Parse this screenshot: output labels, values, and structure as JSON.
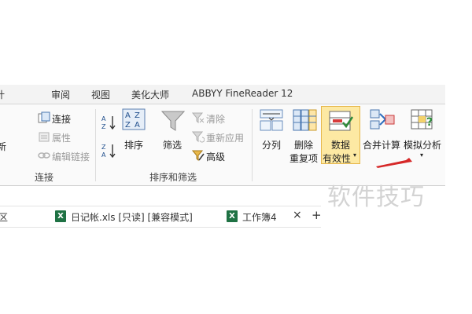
{
  "menu_tabs": {
    "left_fragment": "计",
    "review": "审阅",
    "view": "视图",
    "beautify": "美化大师",
    "abbyy": "ABBYY FineReader 12"
  },
  "ribbon": {
    "connections_group": {
      "left_fragment": "新",
      "connections": "连接",
      "properties": "属性",
      "edit_links": "编辑链接",
      "label": "连接"
    },
    "sort_filter_group": {
      "sort": "排序",
      "filter": "筛选",
      "clear": "清除",
      "reapply": "重新应用",
      "advanced": "高级",
      "label": "排序和筛选"
    },
    "data_tools_group": {
      "text_to_columns": "分列",
      "remove_duplicates_line1": "删除",
      "remove_duplicates_line2": "重复项",
      "data_validation_line1": "数据",
      "data_validation_line2": "有效性",
      "consolidate": "合并计算",
      "what_if": "模拟分析"
    }
  },
  "watermark": "软件技巧",
  "file_tabs": {
    "left_fragment": "区",
    "file1": "日记帐.xls  [只读]  [兼容模式]",
    "file2": "工作簿4",
    "close_symbol": "×",
    "new_symbol": "+"
  },
  "colors": {
    "highlight": "#fde9a3",
    "excel_green": "#1f7244",
    "arrow_red": "#d62828"
  }
}
